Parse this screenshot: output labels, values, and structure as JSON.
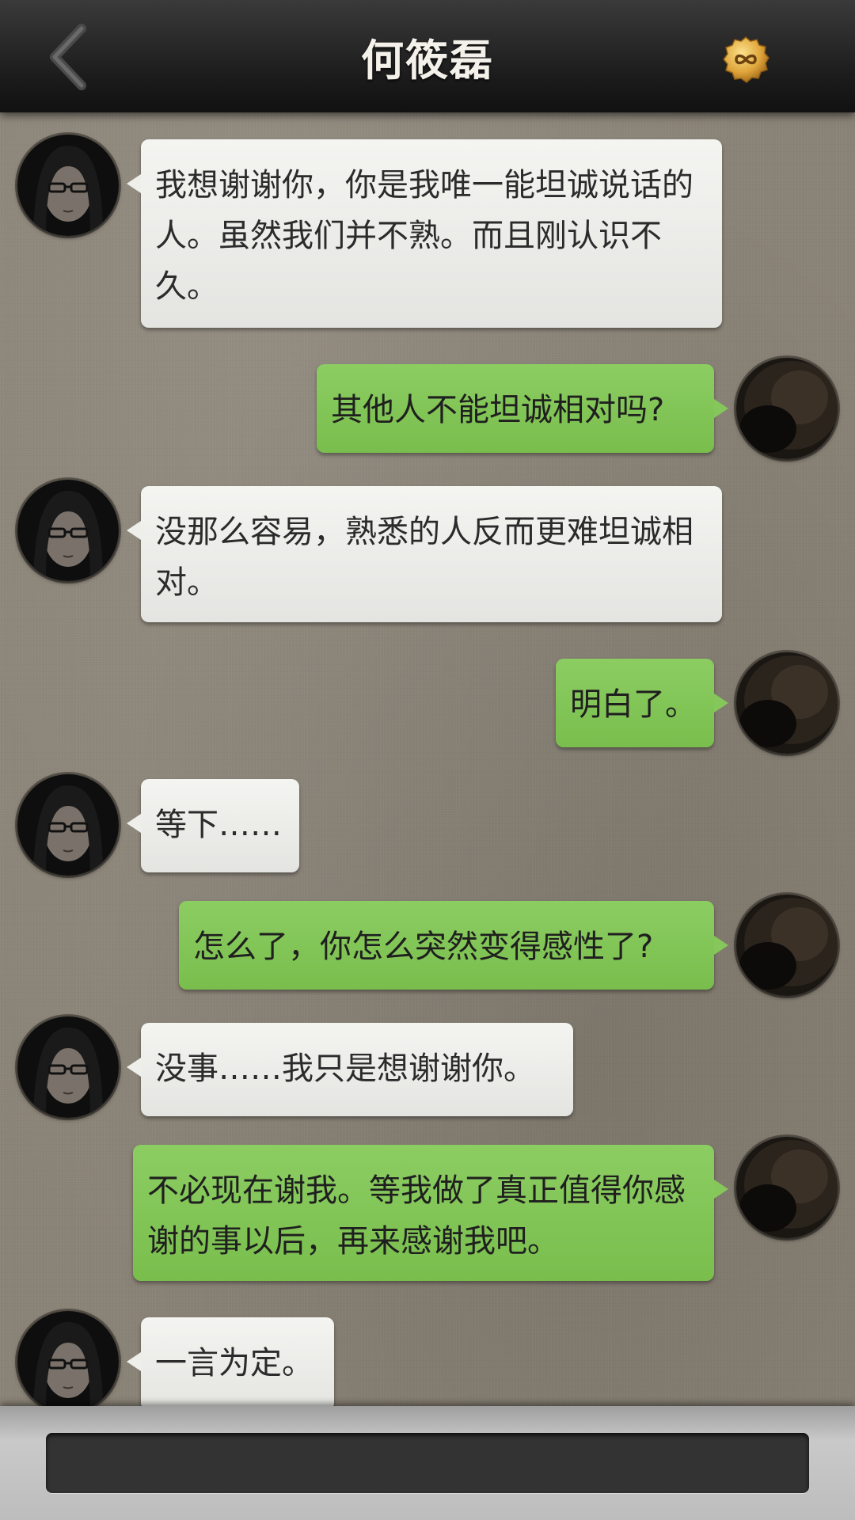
{
  "header": {
    "title": "何筱磊",
    "back_icon": "chevron-left-icon",
    "coin_icon": "infinity-coin-icon",
    "coin_color": "#d9a13a"
  },
  "colors": {
    "incoming_bubble": "#eeeeeb",
    "outgoing_bubble": "#84c65a",
    "background": "#8a8377"
  },
  "messages": [
    {
      "side": "left",
      "text": "我想谢谢你，你是我唯一能坦诚说话的人。虽然我们并不熟。而且刚认识不久。"
    },
    {
      "side": "right",
      "text": "其他人不能坦诚相对吗?"
    },
    {
      "side": "left",
      "text": "没那么容易，熟悉的人反而更难坦诚相对。"
    },
    {
      "side": "right",
      "text": "明白了。"
    },
    {
      "side": "left",
      "text": "等下……"
    },
    {
      "side": "right",
      "text": "怎么了，你怎么突然变得感性了?"
    },
    {
      "side": "left",
      "text": "没事……我只是想谢谢你。"
    },
    {
      "side": "right",
      "text": "不必现在谢我。等我做了真正值得你感谢的事以后，再来感谢我吧。"
    },
    {
      "side": "left",
      "text": "一言为定。"
    }
  ],
  "composer": {
    "input_value": ""
  }
}
